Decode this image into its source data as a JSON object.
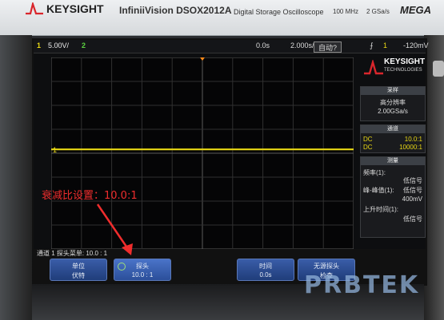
{
  "header": {
    "brand": "KEYSIGHT",
    "model": "InfiniiVision DSOX2012A",
    "subtitle": "Digital Storage Oscilloscope",
    "bandwidth": "100 MHz",
    "sample_rate": "2 GSa/s",
    "series_logo": "MEGA"
  },
  "status": {
    "ch1_label": "1",
    "ch1_scale": "5.00V/",
    "ch2_label": "2",
    "time_pos": "0.0s",
    "time_scale": "2.000s/",
    "run_mode": "自动?",
    "trigger_icon": "rising-edge-icon",
    "trigger_ch": "1",
    "trigger_level": "-120mV"
  },
  "waveform": {
    "ch1_color": "#e9d814",
    "ground_marker": "1",
    "level_fraction": 0.48
  },
  "side_panel": {
    "badge_name": "KEYSIGHT",
    "badge_sub": "TECHNOLOGIES",
    "acquire_title": "采样",
    "acquire_mode": "高分辨率",
    "acquire_rate": "2.00GSa/s",
    "channels_title": "通道",
    "ch1_coupling": "DC",
    "ch1_probe": "10.0:1",
    "ch2_coupling": "DC",
    "ch2_probe": "10000:1",
    "measure_title": "测量",
    "freq_label": "频率(1):",
    "freq_value": "低信号",
    "pkpk_label": "峰-峰值(1):",
    "pkpk_value": "低信号",
    "pkpk_extra": "400mV",
    "rise_label": "上升时间(1):",
    "rise_value": "低信号"
  },
  "softkeys": {
    "probe_info": "通道 1 探头菜单: 10.0 : 1",
    "keys": [
      {
        "title": "单位",
        "value": "伏特"
      },
      {
        "title": "探头",
        "value": "10.0 : 1"
      },
      {
        "title": "时间",
        "value": "0.0s"
      },
      {
        "title": "无源探头",
        "value": "检查"
      }
    ]
  },
  "annotation": {
    "text": "衰减比设置：10.0:1",
    "color": "#f02d2d"
  },
  "watermark": "PRBTEK"
}
